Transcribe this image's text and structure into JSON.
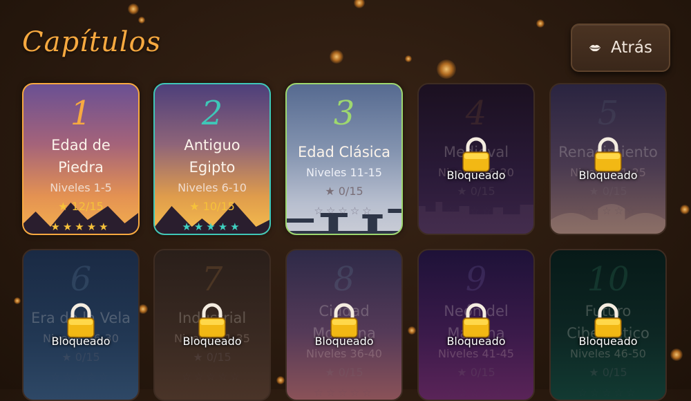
{
  "header": {
    "title": "Capítulos",
    "back_label": "Atrás",
    "back_icon": "lips-icon"
  },
  "lock": {
    "label": "Bloqueado",
    "icon": "padlock-icon"
  },
  "chapters": [
    {
      "number": "1",
      "name_lines": [
        "Edad de",
        "Piedra"
      ],
      "levels": "Niveles 1-5",
      "stars": "★ 12/15",
      "locked": false,
      "accent": "#f7a940",
      "theme": "stone-age",
      "earned_stars": 5
    },
    {
      "number": "2",
      "name_lines": [
        "Antiguo",
        "Egipto"
      ],
      "levels": "Niveles 6-10",
      "stars": "★ 10/15",
      "locked": false,
      "accent": "#3fc7b8",
      "theme": "egypt",
      "earned_stars": 5
    },
    {
      "number": "3",
      "name_lines": [
        "Edad Clásica"
      ],
      "levels": "Niveles 11-15",
      "stars": "★ 0/15",
      "locked": false,
      "accent": "#9ed86f",
      "theme": "classical",
      "earned_stars": 0
    },
    {
      "number": "4",
      "name_lines": [
        "Medieval"
      ],
      "levels": "Niveles 16-20",
      "stars": "★ 0/15",
      "locked": true,
      "accent": "#8a5a32",
      "theme": "medieval",
      "earned_stars": 0
    },
    {
      "number": "5",
      "name_lines": [
        "Renacimiento"
      ],
      "levels": "Niveles 21-25",
      "stars": "★ 0/15",
      "locked": true,
      "accent": "#5a6a7a",
      "theme": "renaissance",
      "earned_stars": 0
    },
    {
      "number": "6",
      "name_lines": [
        "Era de la Vela"
      ],
      "levels": "Niveles 26-30",
      "stars": "★ 0/15",
      "locked": true,
      "accent": "#6a8aa8",
      "theme": "sail",
      "earned_stars": 0
    },
    {
      "number": "7",
      "name_lines": [
        "Industrial"
      ],
      "levels": "Niveles 31-35",
      "stars": "★ 0/15",
      "locked": true,
      "accent": "#b07a40",
      "theme": "industrial",
      "earned_stars": 0
    },
    {
      "number": "8",
      "name_lines": [
        "Ciudad",
        "Moderna"
      ],
      "levels": "Niveles 36-40",
      "stars": "★ 0/15",
      "locked": true,
      "accent": "#6a8aa0",
      "theme": "modern",
      "earned_stars": 0
    },
    {
      "number": "9",
      "name_lines": [
        "Neón del",
        "Mañana"
      ],
      "levels": "Niveles 41-45",
      "stars": "★ 0/15",
      "locked": true,
      "accent": "#7a6ab0",
      "theme": "neon",
      "earned_stars": 0
    },
    {
      "number": "10",
      "name_lines": [
        "Futuro",
        "Cibernético"
      ],
      "levels": "Niveles 46-50",
      "stars": "★ 0/15",
      "locked": true,
      "accent": "#3a8a6a",
      "theme": "cyber",
      "earned_stars": 0
    }
  ]
}
